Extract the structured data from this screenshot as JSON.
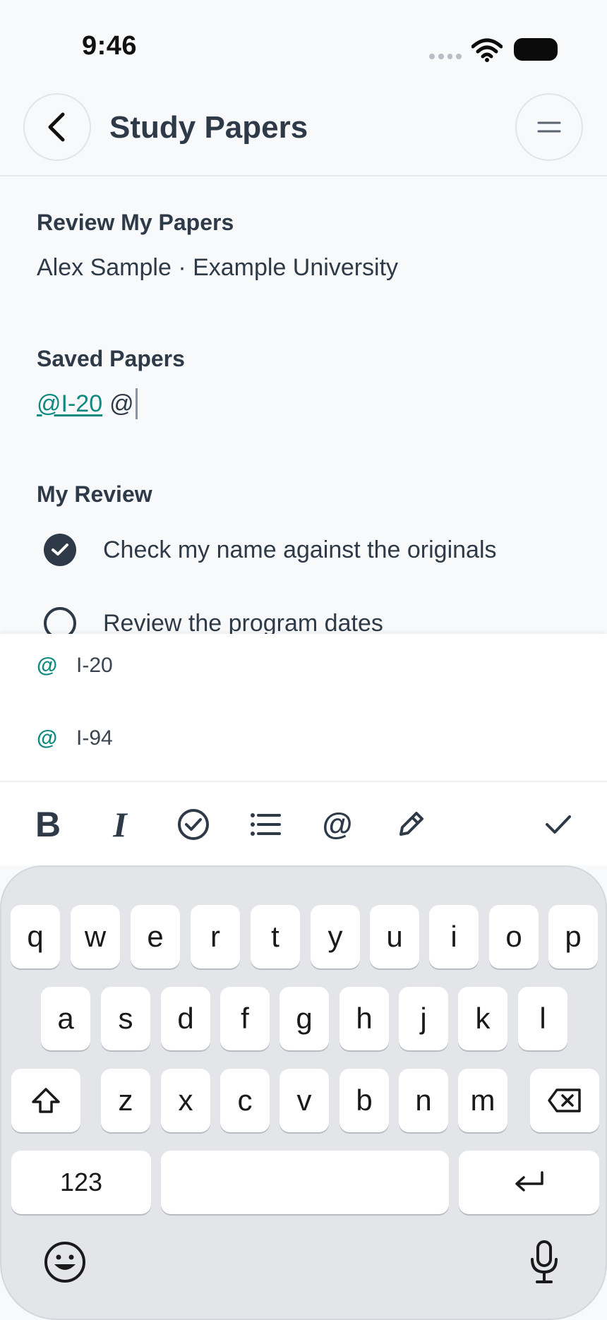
{
  "status_bar": {
    "time": "9:46"
  },
  "nav": {
    "title": "Study Papers"
  },
  "profile": {
    "heading": "Review My Papers",
    "subtitle": "Alex Sample · Example University"
  },
  "saved_papers": {
    "heading": "Saved Papers",
    "mention": "@I-20",
    "pending_at": "@"
  },
  "review": {
    "heading": "My Review",
    "items": [
      {
        "label": "Check my name against the originals",
        "checked": true
      },
      {
        "label": "Review the program dates",
        "checked": false
      }
    ]
  },
  "suggestions": {
    "at_symbol": "@",
    "items": [
      {
        "label": "I-20"
      },
      {
        "label": "I-94"
      }
    ]
  },
  "toolbar": {
    "bold": "B",
    "italic": "I",
    "mention": "@"
  },
  "keyboard": {
    "row1": [
      "q",
      "w",
      "e",
      "r",
      "t",
      "y",
      "u",
      "i",
      "o",
      "p"
    ],
    "row2": [
      "a",
      "s",
      "d",
      "f",
      "g",
      "h",
      "j",
      "k",
      "l"
    ],
    "row3": [
      "z",
      "x",
      "c",
      "v",
      "b",
      "n",
      "m"
    ],
    "numbers_label": "123"
  },
  "colors": {
    "accent": "#0f8a80",
    "text": "#2e3a48",
    "background": "#f7f9fb"
  }
}
